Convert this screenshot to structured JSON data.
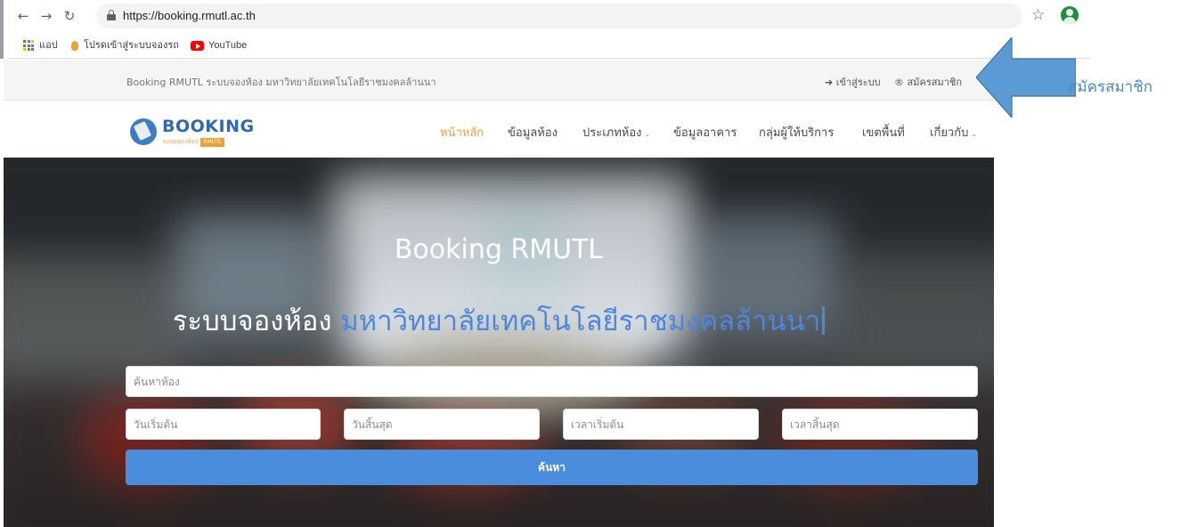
{
  "browser": {
    "url": "https://booking.rmutl.ac.th",
    "bookmarks": [
      {
        "label": "แอป",
        "icon": "apps-icon"
      },
      {
        "label": "โปรดเข้าสู่ระบบจองรถ",
        "icon": "flame-icon"
      },
      {
        "label": "YouTube",
        "icon": "youtube-icon"
      }
    ]
  },
  "topbar": {
    "tagline": "Booking RMUTL ระบบจองห้อง มหาวิทยาลัยเทคโนโลยีราชมงคลล้านนา",
    "login": "➜ เข้าสู่ระบบ",
    "register": "® สมัครสมาชิก"
  },
  "logo": {
    "title": "BOOKING",
    "subtitle": "ระบบจองห้อง",
    "badge": "RMUTL"
  },
  "nav": [
    {
      "label": "หน้าหลัก",
      "active": true
    },
    {
      "label": "ข้อมูลห้อง"
    },
    {
      "label": "ประเภทห้อง",
      "dropdown": true
    },
    {
      "label": "ข้อมูลอาคาร"
    },
    {
      "label": "กลุ่มผู้ให้บริการ"
    },
    {
      "label": "เขตพื้นที่"
    },
    {
      "label": "เกี่ยวกับ",
      "dropdown": true
    }
  ],
  "hero": {
    "title": "Booking RMUTL",
    "subtitle_white": "ระบบจองห้อง",
    "subtitle_blue": "มหาวิทยาลัยเทคโนโลยีราชมงคลล้านนา"
  },
  "search": {
    "room_placeholder": "ค้นหาห้อง",
    "start_date_placeholder": "วันเริ่มต้น",
    "end_date_placeholder": "วันสิ้นสุด",
    "start_time_placeholder": "เวลาเริ่มต้น",
    "end_time_placeholder": "เวลาสิ้นสุด",
    "button": "ค้นหา"
  },
  "annotation": {
    "label": "สมัครสมาชิก"
  },
  "colors": {
    "accent_orange": "#f0a030",
    "brand_blue": "#2f68b3",
    "button_blue": "#4a8ddc",
    "annotation_blue": "#4a86c5"
  }
}
